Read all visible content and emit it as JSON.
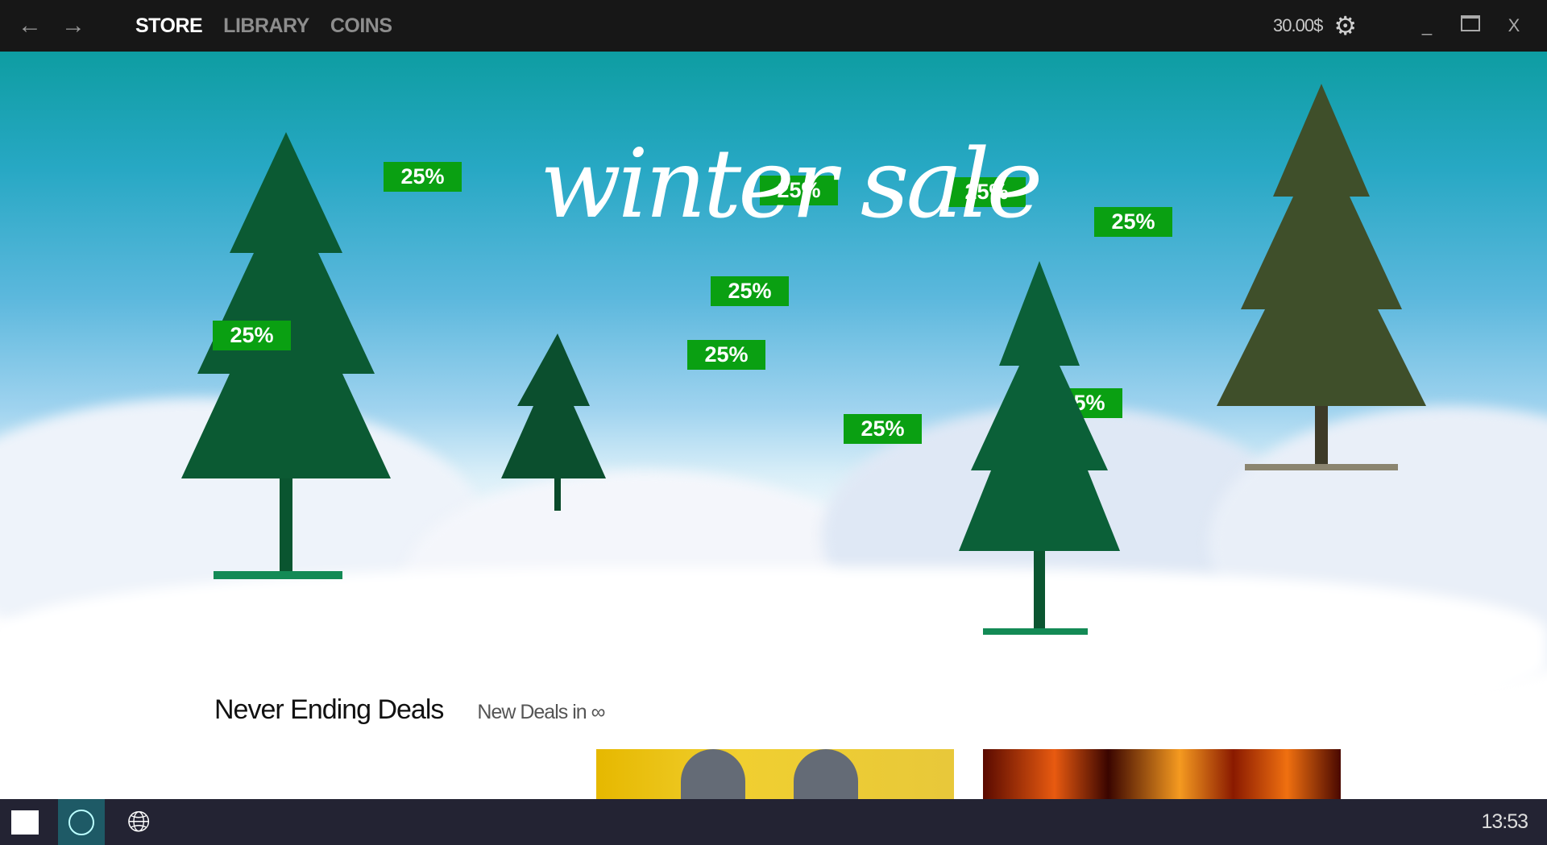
{
  "topbar": {
    "back_icon": "arrow-left",
    "forward_icon": "arrow-right",
    "tabs": [
      {
        "label": "STORE",
        "active": true
      },
      {
        "label": "LIBRARY"
      },
      {
        "label": "COINS"
      }
    ],
    "balance": "30.00$",
    "settings_icon": "gear",
    "minimize": "_",
    "close": "X"
  },
  "hero": {
    "title": "winter sale",
    "badges": [
      "25%",
      "25%",
      "25%",
      "25%",
      "25%",
      "25%",
      "25%",
      "25%",
      "25%"
    ]
  },
  "section": {
    "title": "Never Ending Deals",
    "subtitle": "New Deals in ∞"
  },
  "taskbar": {
    "clock": "13:53"
  },
  "colors": {
    "badge": "#0aa012",
    "topbar": "#171717",
    "taskbar": "#232333",
    "hero_top": "#0e9da2"
  }
}
